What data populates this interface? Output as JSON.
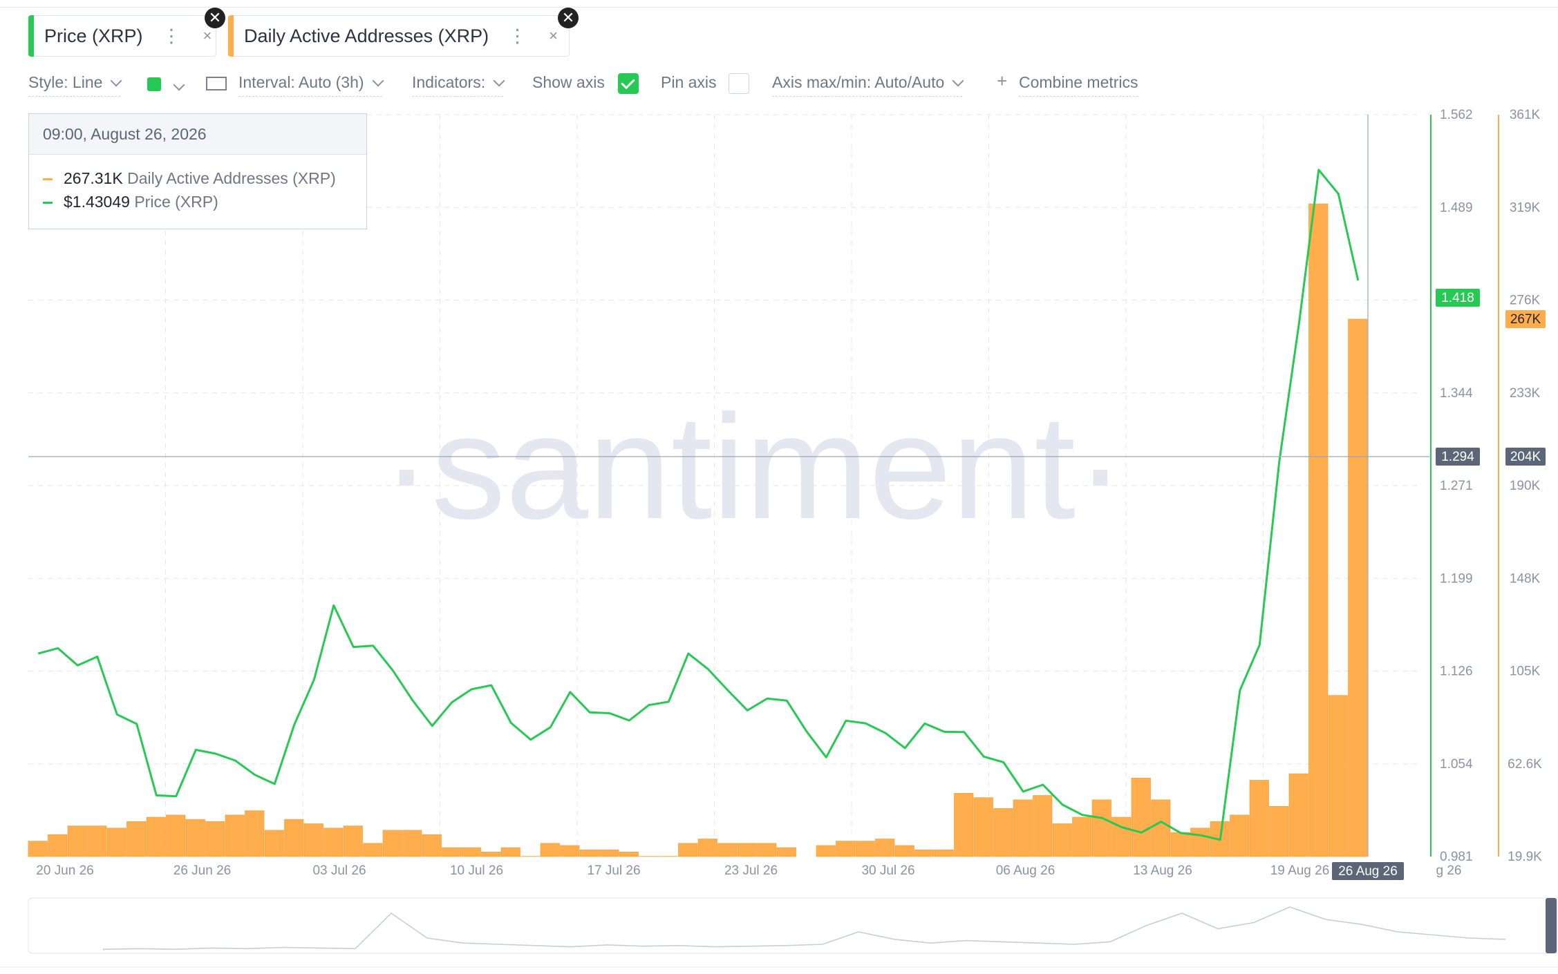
{
  "metrics": [
    {
      "label": "Price (XRP)",
      "color": "#26c953"
    },
    {
      "label": "Daily Active Addresses (XRP)",
      "color": "#ffad4d"
    }
  ],
  "toolbar": {
    "style_label": "Style: Line",
    "interval_label": "Interval: Auto (3h)",
    "indicators_label": "Indicators:",
    "show_axis_label": "Show axis",
    "pin_axis_label": "Pin axis",
    "axis_maxmin_label": "Axis max/min: Auto/Auto",
    "combine_label": "Combine metrics"
  },
  "tooltip": {
    "date": "09:00, August 26, 2026",
    "rows": [
      {
        "value": "267.31K",
        "name": "Daily Active Addresses (XRP)"
      },
      {
        "value": "$1.43049",
        "name": "Price (XRP)"
      }
    ]
  },
  "watermark": "·santiment·",
  "chart_data": {
    "type": "line",
    "x_tick_labels": [
      "20 Jun 26",
      "26 Jun 26",
      "03 Jul 26",
      "10 Jul 26",
      "17 Jul 26",
      "23 Jul 26",
      "30 Jul 26",
      "06 Aug 26",
      "13 Aug 26",
      "19 Aug 26"
    ],
    "x_hover_label": "26 Aug 26",
    "x_trailing_label": "g 26",
    "y_left_ticks": [
      "1.562",
      "1.489",
      "1.344",
      "1.271",
      "1.199",
      "1.126",
      "1.054",
      "0.981"
    ],
    "y_right_ticks": [
      "361K",
      "319K",
      "276K",
      "233K",
      "190K",
      "148K",
      "105K",
      "62.6K",
      "19.9K"
    ],
    "price_badge": "1.418",
    "daa_badge": "267K",
    "crosshair_left": "1.294",
    "crosshair_right": "204K",
    "ylim_price": [
      0.981,
      1.562
    ],
    "ylim_daa": [
      19.9,
      361
    ],
    "series": [
      {
        "name": "Price (XRP)",
        "type": "line",
        "color": "#26c953",
        "x": [
          "2026-06-20",
          "2026-06-21",
          "2026-06-22",
          "2026-06-23",
          "2026-06-24",
          "2026-06-25",
          "2026-06-26",
          "2026-06-27",
          "2026-06-28",
          "2026-06-29",
          "2026-06-30",
          "2026-07-01",
          "2026-07-02",
          "2026-07-03",
          "2026-07-04",
          "2026-07-05",
          "2026-07-06",
          "2026-07-07",
          "2026-07-08",
          "2026-07-09",
          "2026-07-10",
          "2026-07-11",
          "2026-07-12",
          "2026-07-13",
          "2026-07-14",
          "2026-07-15",
          "2026-07-16",
          "2026-07-17",
          "2026-07-18",
          "2026-07-19",
          "2026-07-20",
          "2026-07-21",
          "2026-07-22",
          "2026-07-23",
          "2026-07-24",
          "2026-07-25",
          "2026-07-26",
          "2026-07-27",
          "2026-07-28",
          "2026-07-29",
          "2026-07-30",
          "2026-07-31",
          "2026-08-01",
          "2026-08-02",
          "2026-08-03",
          "2026-08-04",
          "2026-08-05",
          "2026-08-06",
          "2026-08-07",
          "2026-08-08",
          "2026-08-09",
          "2026-08-10",
          "2026-08-11",
          "2026-08-12",
          "2026-08-13",
          "2026-08-14",
          "2026-08-15",
          "2026-08-16",
          "2026-08-17",
          "2026-08-18",
          "2026-08-19",
          "2026-08-20",
          "2026-08-21",
          "2026-08-22",
          "2026-08-23",
          "2026-08-24",
          "2026-08-25",
          "2026-08-26"
        ],
        "values": [
          1.14,
          1.142,
          1.135,
          1.137,
          1.095,
          1.08,
          1.03,
          1.025,
          1.07,
          1.06,
          1.06,
          1.045,
          1.04,
          1.08,
          1.12,
          1.175,
          1.15,
          1.145,
          1.13,
          1.098,
          1.085,
          1.098,
          1.112,
          1.113,
          1.09,
          1.072,
          1.085,
          1.105,
          1.095,
          1.09,
          1.093,
          1.098,
          1.106,
          1.14,
          1.13,
          1.107,
          1.096,
          1.102,
          1.108,
          1.078,
          1.062,
          1.082,
          1.087,
          1.074,
          1.066,
          1.083,
          1.083,
          1.078,
          1.062,
          1.05,
          1.033,
          1.034,
          1.027,
          1.012,
          1.015,
          1.004,
          1.002,
          1.004,
          1.0,
          0.995,
          0.999,
          1.11,
          1.15,
          1.285,
          1.4,
          1.515,
          1.5,
          1.43
        ]
      },
      {
        "name": "Daily Active Addresses (XRP)",
        "type": "bar",
        "color": "#ffad4d",
        "x": [
          "2026-06-20",
          "2026-06-21",
          "2026-06-22",
          "2026-06-23",
          "2026-06-24",
          "2026-06-25",
          "2026-06-26",
          "2026-06-27",
          "2026-06-28",
          "2026-06-29",
          "2026-06-30",
          "2026-07-01",
          "2026-07-02",
          "2026-07-03",
          "2026-07-04",
          "2026-07-05",
          "2026-07-06",
          "2026-07-07",
          "2026-07-08",
          "2026-07-09",
          "2026-07-10",
          "2026-07-11",
          "2026-07-12",
          "2026-07-13",
          "2026-07-14",
          "2026-07-15",
          "2026-07-16",
          "2026-07-17",
          "2026-07-18",
          "2026-07-19",
          "2026-07-20",
          "2026-07-21",
          "2026-07-22",
          "2026-07-23",
          "2026-07-24",
          "2026-07-25",
          "2026-07-26",
          "2026-07-27",
          "2026-07-28",
          "2026-07-29",
          "2026-07-30",
          "2026-07-31",
          "2026-08-01",
          "2026-08-02",
          "2026-08-03",
          "2026-08-04",
          "2026-08-05",
          "2026-08-06",
          "2026-08-07",
          "2026-08-08",
          "2026-08-09",
          "2026-08-10",
          "2026-08-11",
          "2026-08-12",
          "2026-08-13",
          "2026-08-14",
          "2026-08-15",
          "2026-08-16",
          "2026-08-17",
          "2026-08-18",
          "2026-08-19",
          "2026-08-20",
          "2026-08-21",
          "2026-08-22",
          "2026-08-23",
          "2026-08-24",
          "2026-08-25",
          "2026-08-26"
        ],
        "values": [
          27,
          30,
          34,
          34,
          33,
          36,
          38,
          39,
          37,
          36,
          39,
          41,
          32,
          37,
          35,
          33,
          34,
          26,
          32,
          32,
          30,
          24,
          24,
          22,
          24,
          20,
          26,
          25,
          23,
          23,
          22,
          20,
          20,
          26,
          28,
          26,
          26,
          26,
          24,
          19.9,
          25,
          27,
          27,
          28,
          25,
          23,
          23,
          49,
          47,
          42,
          46,
          48,
          35,
          38,
          46,
          38,
          56,
          46,
          31,
          33,
          36,
          39,
          55,
          43,
          58,
          320,
          94,
          267
        ]
      }
    ]
  }
}
